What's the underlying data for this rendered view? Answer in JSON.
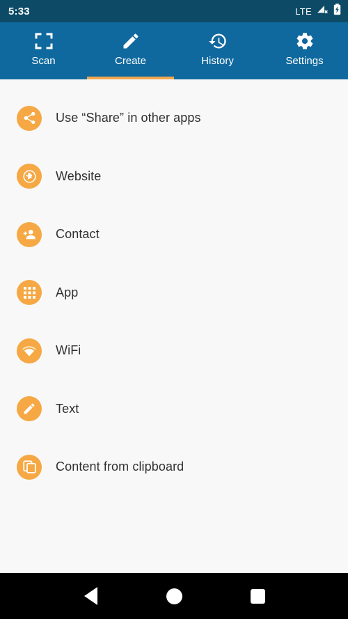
{
  "statusbar": {
    "time": "5:33",
    "network_label": "LTE",
    "signal_icon": "signal-no-service-icon",
    "battery_icon": "battery-charging-icon"
  },
  "tabs": [
    {
      "label": "Scan",
      "icon": "scan-frame-icon",
      "active": false
    },
    {
      "label": "Create",
      "icon": "pencil-icon",
      "active": true
    },
    {
      "label": "History",
      "icon": "history-clock-icon",
      "active": false
    },
    {
      "label": "Settings",
      "icon": "gear-icon",
      "active": false
    }
  ],
  "create_list": [
    {
      "label": "Use “Share” in other apps",
      "icon": "share-icon"
    },
    {
      "label": "Website",
      "icon": "globe-icon"
    },
    {
      "label": "Contact",
      "icon": "person-add-icon"
    },
    {
      "label": "App",
      "icon": "apps-grid-icon"
    },
    {
      "label": "WiFi",
      "icon": "wifi-icon"
    },
    {
      "label": "Text",
      "icon": "pencil-icon"
    },
    {
      "label": "Content from clipboard",
      "icon": "clipboard-copy-icon"
    }
  ],
  "navbar": {
    "back_label": "Back",
    "home_label": "Home",
    "recents_label": "Recents"
  },
  "colors": {
    "status_bar": "#0d4a66",
    "tab_bar": "#10699e",
    "accent": "#efa952",
    "badge": "#f5a843",
    "content_bg": "#f8f8f8",
    "text": "#303030"
  }
}
